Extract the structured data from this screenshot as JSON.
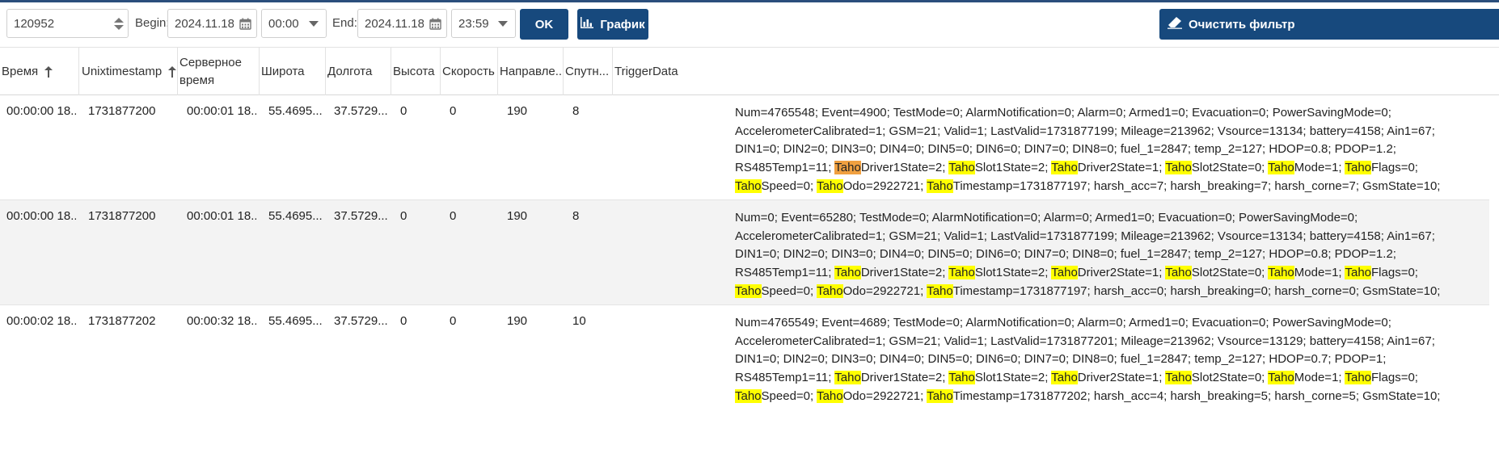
{
  "toolbar": {
    "id_value": "120952",
    "begin_label": "Begin:",
    "begin_date": "2024.11.18",
    "begin_time": "00:00",
    "end_label": "End:",
    "end_date": "2024.11.18",
    "end_time": "23:59",
    "ok_label": "OK",
    "chart_label": "График",
    "clear_label": "Очистить фильтр"
  },
  "columns": [
    "Время",
    "Unixtimestamp",
    "Серверное время",
    "Широта",
    "Долгота",
    "Высота",
    "Скорость",
    "Направле...",
    "Спутн...",
    "TriggerData"
  ],
  "rows": [
    {
      "time": "00:00:00 18...",
      "unix": "1731877200",
      "server": "00:00:01 18...",
      "lat": "55.4695...",
      "lon": "37.5729...",
      "alt": "0",
      "speed": "0",
      "dir": "190",
      "sat": "8",
      "trigger": [
        "Num=4765548; Event=4900; TestMode=0; AlarmNotification=0; Alarm=0; Armed1=0; Evacuation=0; PowerSavingMode=0; AccelerometerCalibrated=1; GSM=21; Valid=1; LastValid=1731877199; Mileage=213962; Vsource=13134; battery=4158; Ain1=67; DIN1=0; DIN2=0; DIN3=0; DIN4=0; DIN5=0; DIN6=0; DIN7=0; DIN8=0; fuel_1=2847; temp_2=127; HDOP=0.8; PDOP=1.2; RS485Temp1=11; ",
        "Taho",
        "Driver1State=2; ",
        "Taho",
        "Slot1State=2; ",
        "Taho",
        "Driver2State=1; ",
        "Taho",
        "Slot2State=0; ",
        "Taho",
        "Mode=1; ",
        "Taho",
        "Flags=0; ",
        "Taho",
        "Speed=0; ",
        "Taho",
        "Odo=2922721; ",
        "Taho",
        "Timestamp=1731877197; harsh_acc=7; harsh_breaking=7; harsh_corne=7; GsmState=10;"
      ]
    },
    {
      "time": "00:00:00 18...",
      "unix": "1731877200",
      "server": "00:00:01 18...",
      "lat": "55.4695...",
      "lon": "37.5729...",
      "alt": "0",
      "speed": "0",
      "dir": "190",
      "sat": "8",
      "trigger": [
        "Num=0; Event=65280; TestMode=0; AlarmNotification=0; Alarm=0; Armed1=0; Evacuation=0; PowerSavingMode=0; AccelerometerCalibrated=1; GSM=21; Valid=1; LastValid=1731877199; Mileage=213962; Vsource=13134; battery=4158; Ain1=67; DIN1=0; DIN2=0; DIN3=0; DIN4=0; DIN5=0; DIN6=0; DIN7=0; DIN8=0; fuel_1=2847; temp_2=127; HDOP=0.8; PDOP=1.2; RS485Temp1=11; ",
        "Taho",
        "Driver1State=2; ",
        "Taho",
        "Slot1State=2; ",
        "Taho",
        "Driver2State=1; ",
        "Taho",
        "Slot2State=0; ",
        "Taho",
        "Mode=1; ",
        "Taho",
        "Flags=0; ",
        "Taho",
        "Speed=0; ",
        "Taho",
        "Odo=2922721; ",
        "Taho",
        "Timestamp=1731877197; harsh_acc=0; harsh_breaking=0; harsh_corne=0; GsmState=10;"
      ]
    },
    {
      "time": "00:00:02 18...",
      "unix": "1731877202",
      "server": "00:00:32 18...",
      "lat": "55.4695...",
      "lon": "37.5729...",
      "alt": "0",
      "speed": "0",
      "dir": "190",
      "sat": "10",
      "trigger": [
        "Num=4765549; Event=4689; TestMode=0; AlarmNotification=0; Alarm=0; Armed1=0; Evacuation=0; PowerSavingMode=0; AccelerometerCalibrated=1; GSM=21; Valid=1; LastValid=1731877201; Mileage=213962; Vsource=13129; battery=4158; Ain1=67; DIN1=0; DIN2=0; DIN3=0; DIN4=0; DIN5=0; DIN6=0; DIN7=0; DIN8=0; fuel_1=2847; temp_2=127; HDOP=0.7; PDOP=1; RS485Temp1=11; ",
        "Taho",
        "Driver1State=2; ",
        "Taho",
        "Slot1State=2; ",
        "Taho",
        "Driver2State=1; ",
        "Taho",
        "Slot2State=0; ",
        "Taho",
        "Mode=1; ",
        "Taho",
        "Flags=0; ",
        "Taho",
        "Speed=0; ",
        "Taho",
        "Odo=2922721; ",
        "Taho",
        "Timestamp=1731877202; harsh_acc=4; harsh_breaking=5; harsh_corne=5; GsmState=10;"
      ]
    }
  ],
  "highlight_color": "#ffff00",
  "current_highlight_color": "#f0a040",
  "accent_color": "#17497d"
}
